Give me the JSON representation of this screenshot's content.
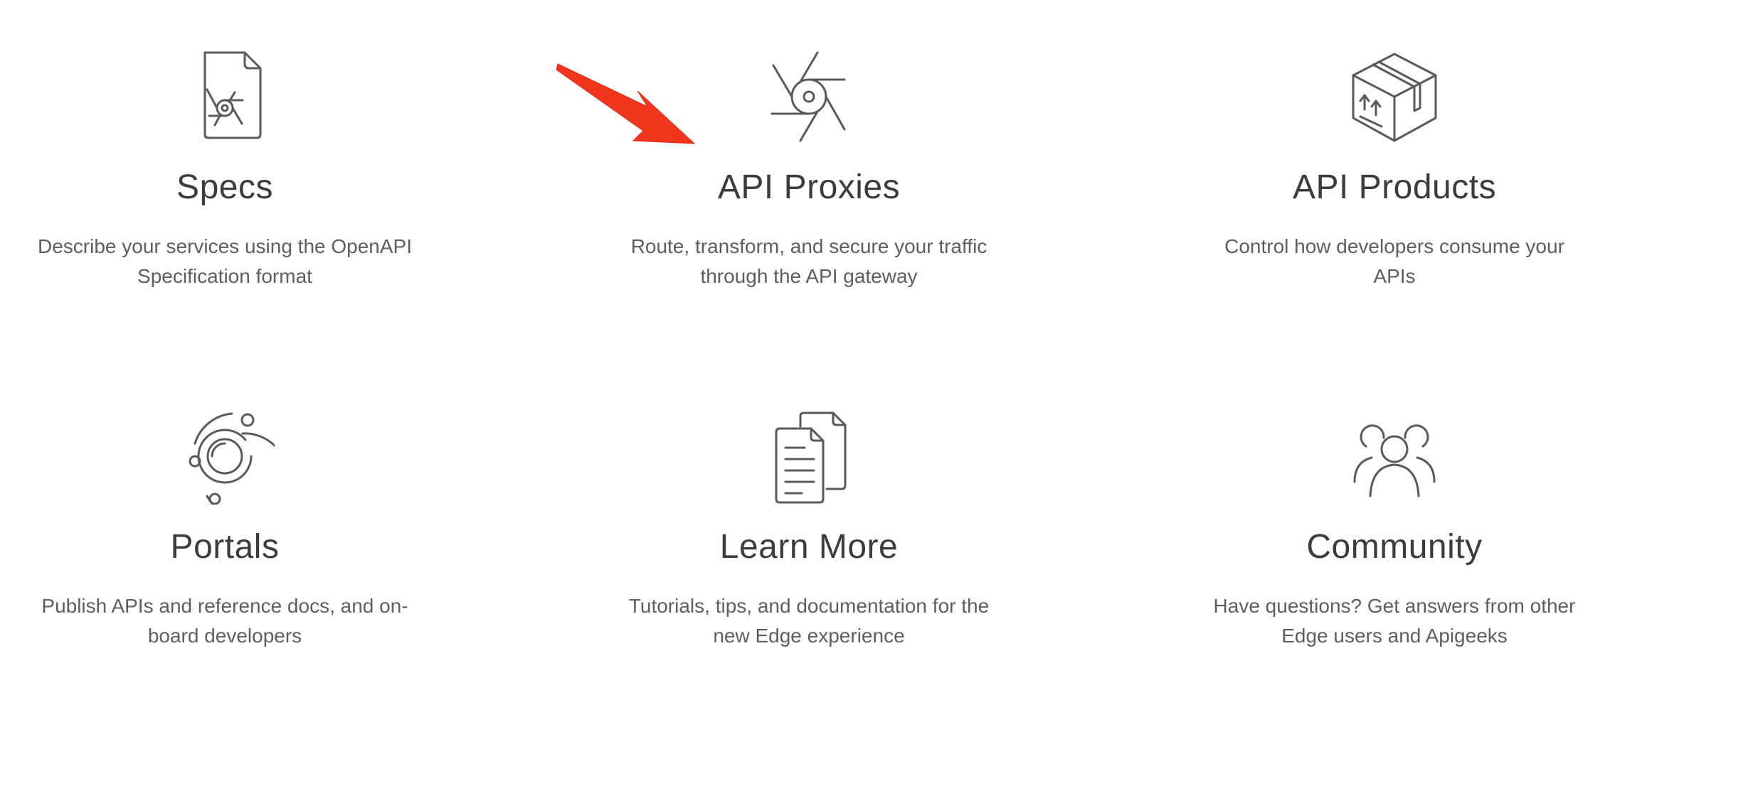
{
  "cards": [
    {
      "id": "specs",
      "icon": "spec-document-icon",
      "title": "Specs",
      "description": "Describe your services using the OpenAPI Specification format"
    },
    {
      "id": "api-proxies",
      "icon": "proxy-shutter-icon",
      "title": "API Proxies",
      "description": "Route, transform, and secure your traffic through the API gateway"
    },
    {
      "id": "api-products",
      "icon": "package-box-icon",
      "title": "API Products",
      "description": "Control how developers consume your APIs"
    },
    {
      "id": "portals",
      "icon": "portal-orbit-icon",
      "title": "Portals",
      "description": "Publish APIs and reference docs, and on-board developers"
    },
    {
      "id": "learn-more",
      "icon": "documents-icon",
      "title": "Learn More",
      "description": "Tutorials, tips, and documentation for the new Edge experience"
    },
    {
      "id": "community",
      "icon": "people-group-icon",
      "title": "Community",
      "description": "Have questions? Get answers from other Edge users and Apigeeks"
    }
  ],
  "annotation": {
    "icon": "red-arrow-icon",
    "color": "#f2361d"
  },
  "colors": {
    "icon_stroke": "#5a5a5a",
    "title": "#3c3c3c",
    "description": "#5e5e5e"
  }
}
